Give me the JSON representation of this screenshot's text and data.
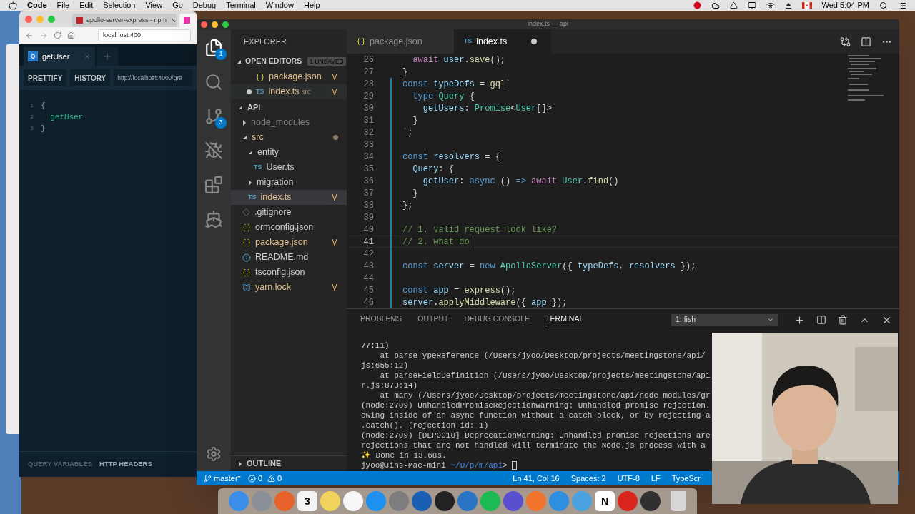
{
  "menubar": {
    "app": "Code",
    "menus": [
      "File",
      "Edit",
      "Selection",
      "View",
      "Go",
      "Debug",
      "Terminal",
      "Window",
      "Help"
    ],
    "clock": "Wed 5:04 PM"
  },
  "browser": {
    "tabs": [
      {
        "title": "apollo-server-express - npm",
        "selected": false
      },
      {
        "selected": true
      }
    ],
    "address": "localhost:400",
    "playground": {
      "tab": {
        "badge": "Q",
        "label": "getUser"
      },
      "buttons": [
        "PRETTIFY",
        "HISTORY"
      ],
      "endpoint": "http://localhost:4000/gra",
      "lines": [
        {
          "number": "1",
          "text": "{"
        },
        {
          "number": "2",
          "text": "  getUser"
        },
        {
          "number": "3",
          "text": "}"
        }
      ],
      "footer": [
        "QUERY VARIABLES",
        "HTTP HEADERS"
      ]
    }
  },
  "vscode": {
    "title": "index.ts — api",
    "activity": [
      {
        "kind": "files",
        "badge": "1",
        "selected": true
      },
      {
        "kind": "search",
        "selected": false
      },
      {
        "kind": "scm",
        "badge": "3",
        "selected": false
      },
      {
        "kind": "nobug",
        "selected": false
      },
      {
        "kind": "extensions",
        "selected": false
      },
      {
        "kind": "docker",
        "selected": false
      }
    ],
    "explorer": {
      "title": "EXPLORER",
      "open_editors": {
        "title": "OPEN EDITORS",
        "badge": "1 UNSAVED",
        "items": [
          {
            "name": "package.json",
            "kind": "json",
            "status": "M",
            "unsaved": false
          },
          {
            "name": "index.ts",
            "kind": "ts",
            "icon_text": "TS",
            "folder": "src",
            "status": "M",
            "unsaved": true
          }
        ]
      },
      "project": {
        "title": "API",
        "expanded": true,
        "items": [
          {
            "name": "node_modules",
            "kind": "folder",
            "expanded": false,
            "ignored": true,
            "selected": false
          },
          {
            "name": "src",
            "kind": "folder",
            "expanded": true,
            "dirty": true,
            "selected": false,
            "children": [
              {
                "name": "entity",
                "kind": "folder",
                "expanded": true,
                "selected": false,
                "children": [
                  {
                    "name": "User.ts",
                    "kind": "ts",
                    "icon_text": "TS",
                    "selected": false
                  }
                ]
              },
              {
                "name": "migration",
                "kind": "folder",
                "expanded": false,
                "selected": false
              },
              {
                "name": "index.ts",
                "kind": "ts",
                "icon_text": "TS",
                "status": "M",
                "selected": true
              }
            ]
          },
          {
            "name": ".gitignore",
            "kind": "git",
            "selected": false
          },
          {
            "name": "ormconfig.json",
            "kind": "json",
            "selected": false
          },
          {
            "name": "package.json",
            "kind": "json",
            "status": "M",
            "selected": false
          },
          {
            "name": "README.md",
            "kind": "info",
            "selected": false
          },
          {
            "name": "tsconfig.json",
            "kind": "json",
            "selected": false
          },
          {
            "name": "yarn.lock",
            "kind": "yarn",
            "status": "M",
            "selected": false
          }
        ]
      },
      "outline": {
        "title": "OUTLINE",
        "expanded": false
      }
    },
    "editor_tabs": [
      {
        "name": "package.json",
        "kind": "json",
        "selected": false,
        "unsaved": false
      },
      {
        "name": "index.ts",
        "kind": "ts",
        "icon_text": "TS",
        "selected": true,
        "unsaved": true
      }
    ],
    "code": [
      {
        "number": "26",
        "changed": false,
        "current": false,
        "tokens": [
          {
            "text": "  await",
            "kind": "kw"
          },
          {
            "text": " user",
            "kind": "var"
          },
          {
            "text": ".",
            "kind": "p"
          },
          {
            "text": "save",
            "kind": "fn"
          },
          {
            "text": "();",
            "kind": "p"
          }
        ]
      },
      {
        "number": "27",
        "changed": false,
        "current": false,
        "tokens": [
          {
            "text": "}",
            "kind": "p"
          }
        ]
      },
      {
        "number": "28",
        "changed": true,
        "current": false,
        "tokens": [
          {
            "text": "const",
            "kind": "decl"
          },
          {
            "text": " typeDefs",
            "kind": "var"
          },
          {
            "text": " = ",
            "kind": "p"
          },
          {
            "text": "gql",
            "kind": "fn"
          },
          {
            "text": "`",
            "kind": "str"
          }
        ]
      },
      {
        "number": "29",
        "changed": true,
        "current": false,
        "tokens": [
          {
            "text": "  type",
            "kind": "decl"
          },
          {
            "text": " Query",
            "kind": "type"
          },
          {
            "text": " {",
            "kind": "p"
          }
        ]
      },
      {
        "number": "30",
        "changed": true,
        "current": false,
        "tokens": [
          {
            "text": "    getUsers",
            "kind": "var"
          },
          {
            "text": ": ",
            "kind": "p"
          },
          {
            "text": "Promise",
            "kind": "type"
          },
          {
            "text": "<",
            "kind": "p"
          },
          {
            "text": "User",
            "kind": "type"
          },
          {
            "text": "[]>",
            "kind": "p"
          }
        ]
      },
      {
        "number": "31",
        "changed": true,
        "current": false,
        "tokens": [
          {
            "text": "  }",
            "kind": "p"
          }
        ]
      },
      {
        "number": "32",
        "changed": true,
        "current": false,
        "tokens": [
          {
            "text": "`",
            "kind": "str"
          },
          {
            "text": ";",
            "kind": "p"
          }
        ]
      },
      {
        "number": "33",
        "changed": true,
        "current": false
      },
      {
        "number": "34",
        "changed": true,
        "current": false,
        "tokens": [
          {
            "text": "const",
            "kind": "decl"
          },
          {
            "text": " resolvers",
            "kind": "var"
          },
          {
            "text": " = {",
            "kind": "p"
          }
        ]
      },
      {
        "number": "35",
        "changed": true,
        "current": false,
        "tokens": [
          {
            "text": "  Query",
            "kind": "var"
          },
          {
            "text": ": {",
            "kind": "p"
          }
        ]
      },
      {
        "number": "36",
        "changed": true,
        "current": false,
        "tokens": [
          {
            "text": "    getUser",
            "kind": "var"
          },
          {
            "text": ": ",
            "kind": "p"
          },
          {
            "text": "async",
            "kind": "decl"
          },
          {
            "text": " () ",
            "kind": "p"
          },
          {
            "text": "=>",
            "kind": "decl"
          },
          {
            "text": " await",
            "kind": "kw"
          },
          {
            "text": " User",
            "kind": "type"
          },
          {
            "text": ".",
            "kind": "p"
          },
          {
            "text": "find",
            "kind": "fn"
          },
          {
            "text": "()",
            "kind": "p"
          }
        ]
      },
      {
        "number": "37",
        "changed": true,
        "current": false,
        "tokens": [
          {
            "text": "  }",
            "kind": "p"
          }
        ]
      },
      {
        "number": "38",
        "changed": true,
        "current": false,
        "tokens": [
          {
            "text": "};",
            "kind": "p"
          }
        ]
      },
      {
        "number": "39",
        "changed": true,
        "current": false
      },
      {
        "number": "40",
        "changed": true,
        "current": false,
        "tokens": [
          {
            "text": "// 1. valid request look like?",
            "kind": "comment"
          }
        ]
      },
      {
        "number": "41",
        "changed": true,
        "current": true,
        "tokens": [
          {
            "text": "// 2. what do",
            "kind": "comment"
          }
        ]
      },
      {
        "number": "42",
        "changed": true,
        "current": false
      },
      {
        "number": "43",
        "changed": true,
        "current": false,
        "tokens": [
          {
            "text": "const",
            "kind": "decl"
          },
          {
            "text": " server",
            "kind": "var"
          },
          {
            "text": " = ",
            "kind": "p"
          },
          {
            "text": "new",
            "kind": "decl"
          },
          {
            "text": " ApolloServer",
            "kind": "type"
          },
          {
            "text": "({ ",
            "kind": "p"
          },
          {
            "text": "typeDefs",
            "kind": "var"
          },
          {
            "text": ", ",
            "kind": "p"
          },
          {
            "text": "resolvers",
            "kind": "var"
          },
          {
            "text": " });",
            "kind": "p"
          }
        ]
      },
      {
        "number": "44",
        "changed": true,
        "current": false
      },
      {
        "number": "45",
        "changed": true,
        "current": false,
        "tokens": [
          {
            "text": "const",
            "kind": "decl"
          },
          {
            "text": " app",
            "kind": "var"
          },
          {
            "text": " = ",
            "kind": "p"
          },
          {
            "text": "express",
            "kind": "fn"
          },
          {
            "text": "();",
            "kind": "p"
          }
        ]
      },
      {
        "number": "46",
        "changed": true,
        "current": false,
        "tokens": [
          {
            "text": "server",
            "kind": "var"
          },
          {
            "text": ".",
            "kind": "p"
          },
          {
            "text": "applyMiddleware",
            "kind": "fn"
          },
          {
            "text": "({ ",
            "kind": "p"
          },
          {
            "text": "app",
            "kind": "var"
          },
          {
            "text": " });",
            "kind": "p"
          }
        ]
      }
    ],
    "panel": {
      "tabs": [
        {
          "label": "PROBLEMS",
          "selected": false
        },
        {
          "label": "OUTPUT",
          "selected": false
        },
        {
          "label": "DEBUG CONSOLE",
          "selected": false
        },
        {
          "label": "TERMINAL",
          "selected": true
        }
      ],
      "terminal_select": "1: fish",
      "lines": [
        "77:11)",
        "    at parseTypeReference (/Users/jyoo/Desktop/projects/meetingstone/api/",
        "js:655:12)",
        "    at parseFieldDefinition (/Users/jyoo/Desktop/projects/meetingstone/api",
        "r.js:873:14)",
        "    at many (/Users/jyoo/Desktop/projects/meetingstone/api/node_modules/gr",
        "(node:2709) UnhandledPromiseRejectionWarning: Unhandled promise rejection.",
        "owing inside of an async function without a catch block, or by rejecting a",
        ".catch(). (rejection id: 1)",
        "(node:2709) [DEP0018] DeprecationWarning: Unhandled promise rejections are",
        "rejections that are not handled will terminate the Node.js process with a",
        "✨ Done in 13.68s."
      ],
      "prompt": {
        "user": "jyoo@Jins-Mac-mini",
        "path": "~/D/p/m/api",
        "symbol": ">"
      }
    },
    "status": {
      "branch": "master*",
      "errors": "0",
      "warnings": "0",
      "right": [
        "Ln 41, Col 16",
        "Spaces: 2",
        "UTF-8",
        "LF",
        "TypeScr"
      ]
    }
  },
  "dock": [
    {
      "kind": "app",
      "color": "#3b8ee8"
    },
    {
      "kind": "app",
      "color": "#8a8f98"
    },
    {
      "kind": "app",
      "color": "#e8632b"
    },
    {
      "kind": "calendar",
      "color": "#f4f4f4",
      "text": "3"
    },
    {
      "kind": "app",
      "color": "#f2d35b"
    },
    {
      "kind": "app",
      "color": "#f7f7f7"
    },
    {
      "kind": "app",
      "color": "#1e90f0"
    },
    {
      "kind": "app",
      "color": "#7d7d80"
    },
    {
      "kind": "app",
      "color": "#1a5fb4"
    },
    {
      "kind": "app",
      "color": "#222222"
    },
    {
      "kind": "app",
      "color": "#2a74c5"
    },
    {
      "kind": "app",
      "color": "#1db954"
    },
    {
      "kind": "app",
      "color": "#5a4fcf"
    },
    {
      "kind": "app",
      "color": "#f0742c"
    },
    {
      "kind": "app",
      "color": "#2c8fe0"
    },
    {
      "kind": "app",
      "color": "#4aa3df"
    },
    {
      "kind": "calendar",
      "color": "#ffffff",
      "text": "N"
    },
    {
      "kind": "app",
      "color": "#d9251d"
    },
    {
      "kind": "app",
      "color": "#303030"
    },
    {
      "kind": "trash",
      "color": "#d8d8d8"
    }
  ]
}
